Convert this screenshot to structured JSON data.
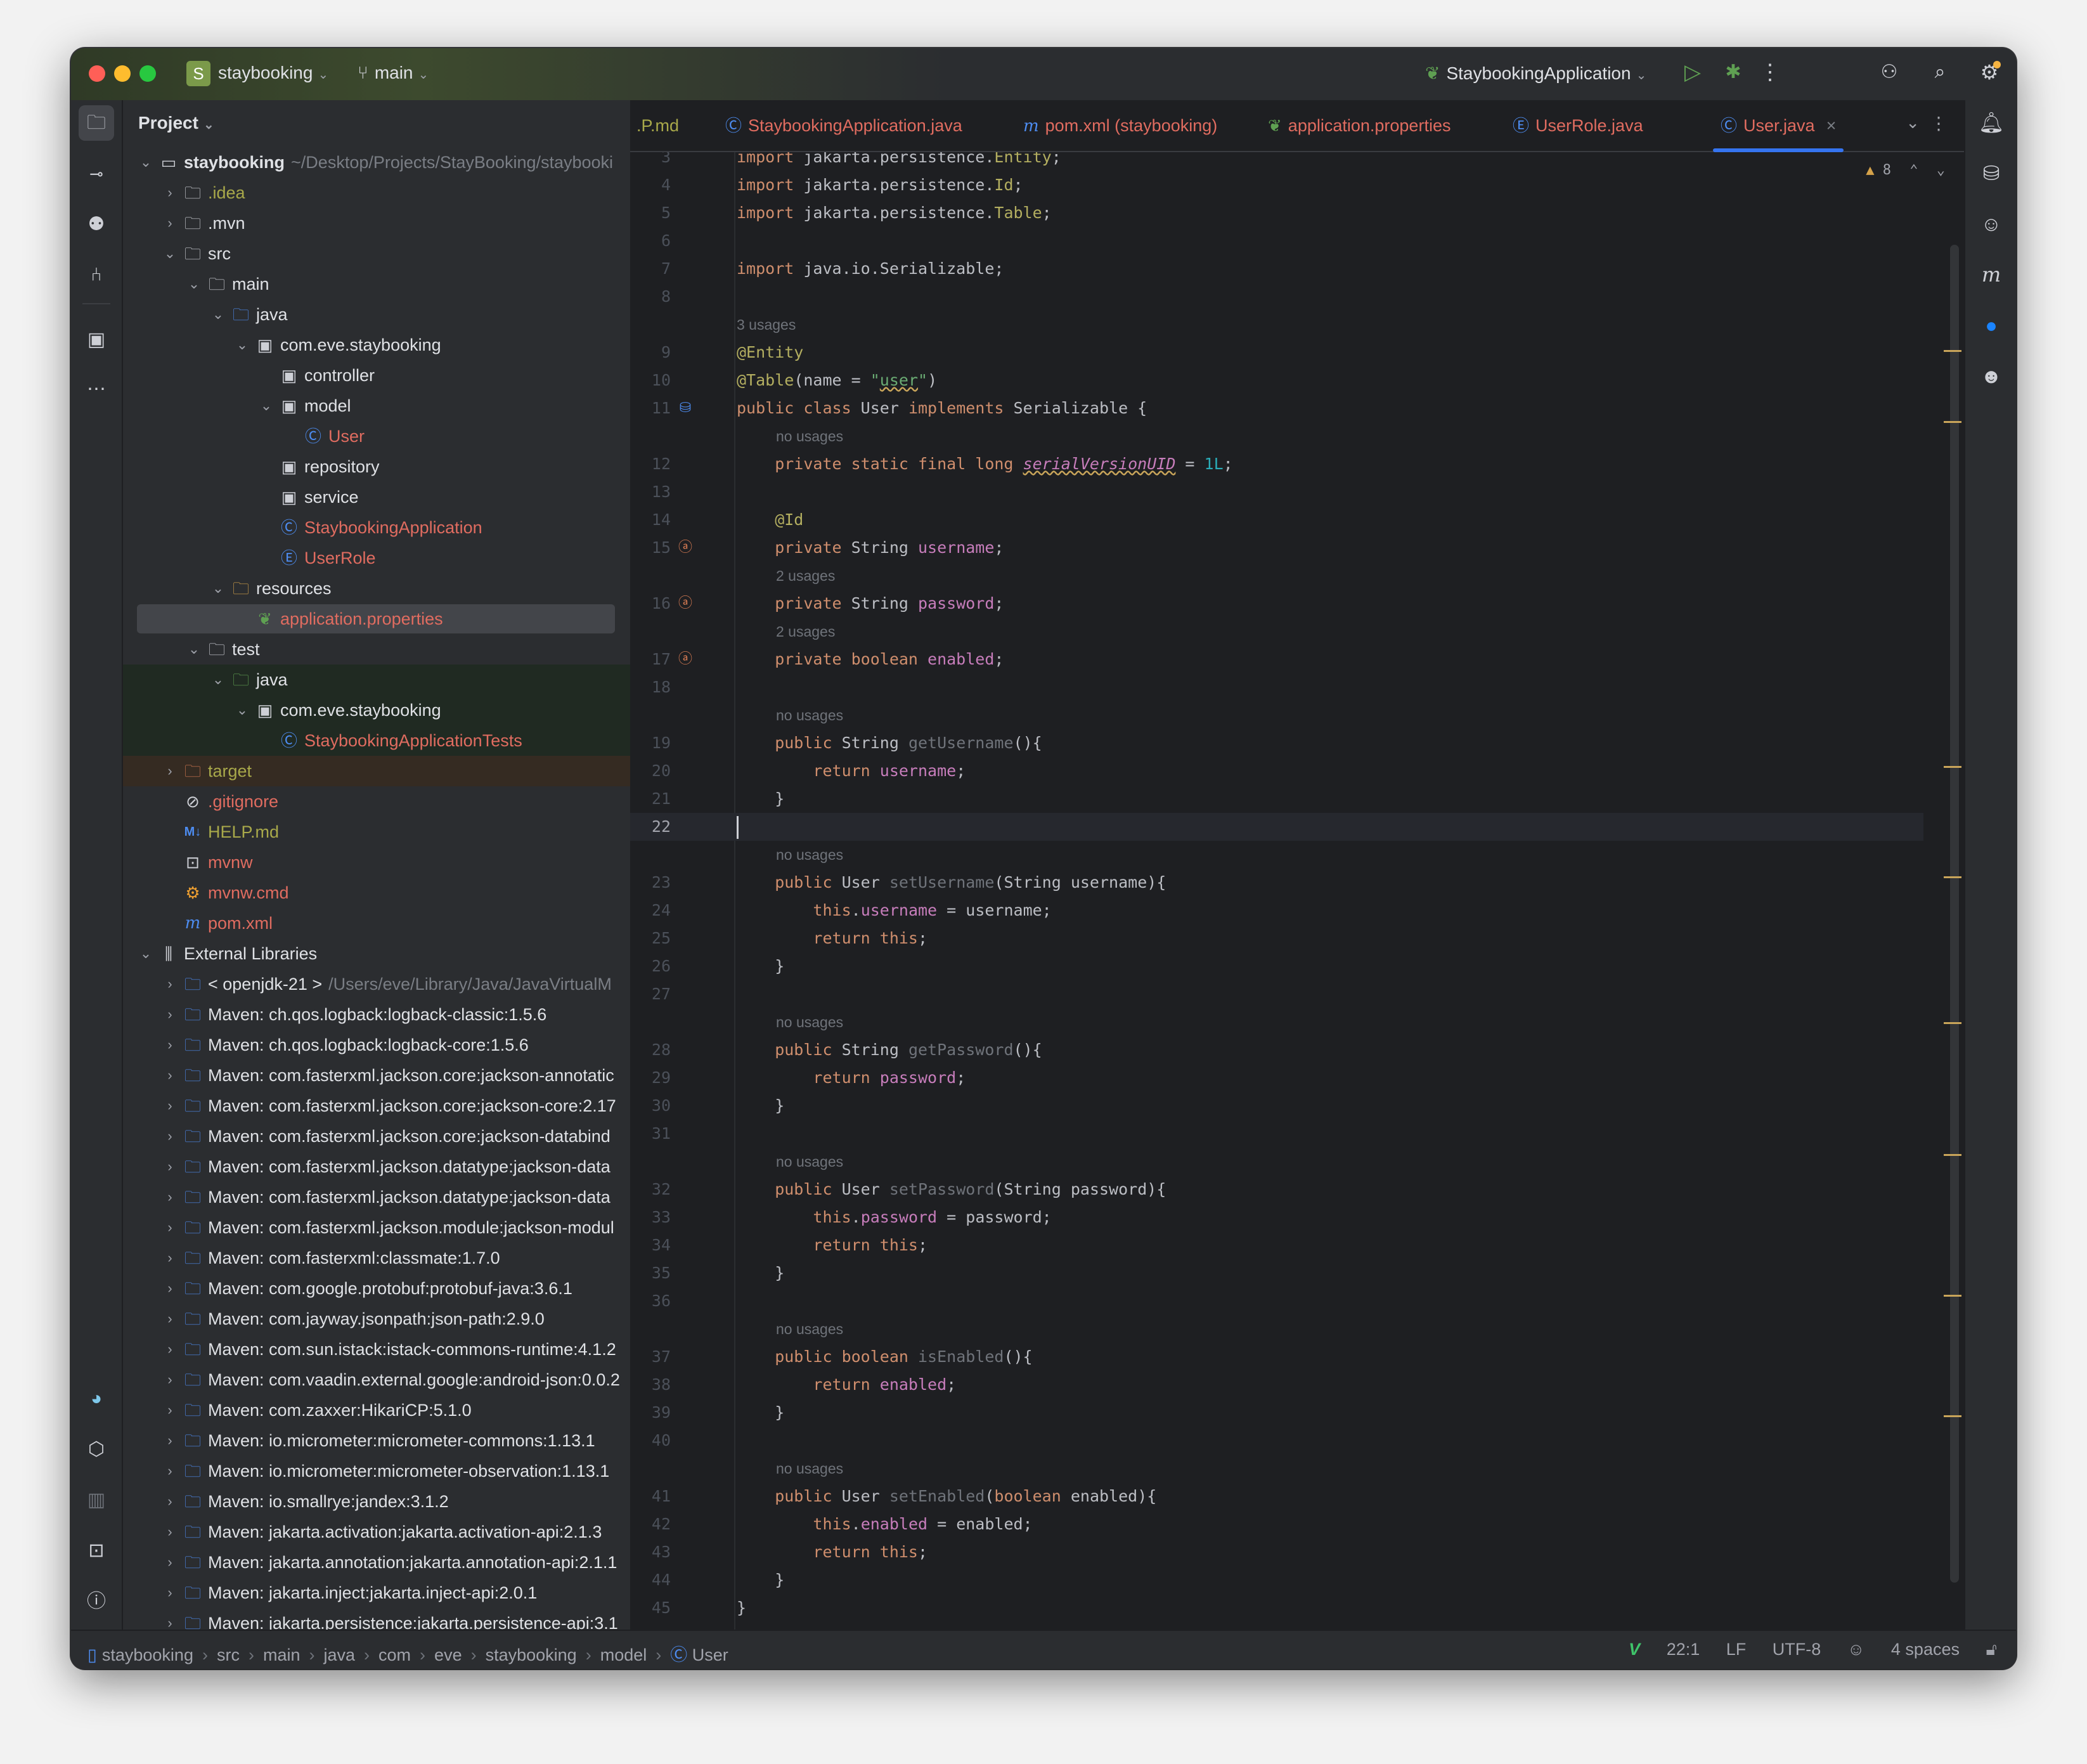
{
  "window": {
    "project_badge": "S",
    "project_name": "staybooking",
    "branch": "main",
    "run_config": "StaybookingApplication",
    "traffic_lights": {
      "close": "#ff5f57",
      "minimize": "#febc2e",
      "zoom": "#28c840"
    }
  },
  "left_toolbar": [
    {
      "name": "project-icon",
      "glyph": "🗀"
    },
    {
      "name": "commit-icon",
      "glyph": "-o-"
    },
    {
      "name": "ai-assistant-icon",
      "glyph": "?"
    },
    {
      "name": "pull-requests-icon",
      "glyph": "⇅"
    },
    {
      "name": "structure-icon",
      "glyph": "▣"
    },
    {
      "name": "more-icon",
      "glyph": "⋯"
    }
  ],
  "left_toolbar_bottom": [
    {
      "name": "gopher-plugin-icon",
      "glyph": "◕"
    },
    {
      "name": "services-icon",
      "glyph": "⬡"
    },
    {
      "name": "bracket-icon",
      "glyph": "[]"
    },
    {
      "name": "terminal-icon",
      "glyph": ">_"
    },
    {
      "name": "problems-icon",
      "glyph": "!"
    },
    {
      "name": "git-icon",
      "glyph": "⑂"
    }
  ],
  "project_panel": {
    "title": "Project",
    "tree": [
      {
        "depth": 0,
        "arrow": "down",
        "icon": "module",
        "label": "staybooking",
        "path": "~/Desktop/Projects/StayBooking/staybooki",
        "bold": true
      },
      {
        "depth": 1,
        "arrow": "right",
        "icon": "folder",
        "label": ".idea",
        "color": "olive"
      },
      {
        "depth": 1,
        "arrow": "right",
        "icon": "folder",
        "label": ".mvn"
      },
      {
        "depth": 1,
        "arrow": "down",
        "icon": "folder",
        "label": "src"
      },
      {
        "depth": 2,
        "arrow": "down",
        "icon": "folder",
        "label": "main"
      },
      {
        "depth": 3,
        "arrow": "down",
        "icon": "source-folder",
        "label": "java"
      },
      {
        "depth": 4,
        "arrow": "down",
        "icon": "package",
        "label": "com.eve.staybooking"
      },
      {
        "depth": 5,
        "arrow": "none",
        "icon": "package",
        "label": "controller"
      },
      {
        "depth": 5,
        "arrow": "down",
        "icon": "package",
        "label": "model"
      },
      {
        "depth": 6,
        "arrow": "none",
        "icon": "class",
        "label": "User",
        "color": "red"
      },
      {
        "depth": 5,
        "arrow": "none",
        "icon": "package",
        "label": "repository"
      },
      {
        "depth": 5,
        "arrow": "none",
        "icon": "package",
        "label": "service"
      },
      {
        "depth": 5,
        "arrow": "none",
        "icon": "spring-class",
        "label": "StaybookingApplication",
        "color": "red"
      },
      {
        "depth": 5,
        "arrow": "none",
        "icon": "enum",
        "label": "UserRole",
        "color": "red"
      },
      {
        "depth": 3,
        "arrow": "down",
        "icon": "resources-folder",
        "label": "resources"
      },
      {
        "depth": 4,
        "arrow": "none",
        "icon": "spring-leaf",
        "label": "application.properties",
        "color": "red",
        "selected": true
      },
      {
        "depth": 2,
        "arrow": "down",
        "icon": "folder",
        "label": "test"
      },
      {
        "depth": 3,
        "arrow": "down",
        "icon": "test-folder",
        "label": "java",
        "bg": "green"
      },
      {
        "depth": 4,
        "arrow": "down",
        "icon": "package",
        "label": "com.eve.staybooking",
        "bg": "green"
      },
      {
        "depth": 5,
        "arrow": "none",
        "icon": "class",
        "label": "StaybookingApplicationTests",
        "color": "red",
        "bg": "green"
      },
      {
        "depth": 1,
        "arrow": "right",
        "icon": "excluded-folder",
        "label": "target",
        "color": "olive",
        "bg": "brown"
      },
      {
        "depth": 1,
        "arrow": "none",
        "icon": "ignore",
        "label": ".gitignore",
        "color": "red"
      },
      {
        "depth": 1,
        "arrow": "none",
        "icon": "markdown",
        "label": "HELP.md",
        "color": "olive"
      },
      {
        "depth": 1,
        "arrow": "none",
        "icon": "shell",
        "label": "mvnw",
        "color": "red"
      },
      {
        "depth": 1,
        "arrow": "none",
        "icon": "cmd",
        "label": "mvnw.cmd",
        "color": "red"
      },
      {
        "depth": 1,
        "arrow": "none",
        "icon": "maven",
        "label": "pom.xml",
        "color": "red"
      },
      {
        "depth": 0,
        "arrow": "down",
        "icon": "libraries",
        "label": "External Libraries"
      },
      {
        "depth": 1,
        "arrow": "right",
        "icon": "jdk",
        "label": "< openjdk-21 >",
        "path": "/Users/eve/Library/Java/JavaVirtualM"
      },
      {
        "depth": 1,
        "arrow": "right",
        "icon": "library",
        "label": "Maven: ch.qos.logback:logback-classic:1.5.6"
      },
      {
        "depth": 1,
        "arrow": "right",
        "icon": "library",
        "label": "Maven: ch.qos.logback:logback-core:1.5.6"
      },
      {
        "depth": 1,
        "arrow": "right",
        "icon": "library",
        "label": "Maven: com.fasterxml.jackson.core:jackson-annotatic"
      },
      {
        "depth": 1,
        "arrow": "right",
        "icon": "library",
        "label": "Maven: com.fasterxml.jackson.core:jackson-core:2.17"
      },
      {
        "depth": 1,
        "arrow": "right",
        "icon": "library",
        "label": "Maven: com.fasterxml.jackson.core:jackson-databind"
      },
      {
        "depth": 1,
        "arrow": "right",
        "icon": "library",
        "label": "Maven: com.fasterxml.jackson.datatype:jackson-data"
      },
      {
        "depth": 1,
        "arrow": "right",
        "icon": "library",
        "label": "Maven: com.fasterxml.jackson.datatype:jackson-data"
      },
      {
        "depth": 1,
        "arrow": "right",
        "icon": "library",
        "label": "Maven: com.fasterxml.jackson.module:jackson-modul"
      },
      {
        "depth": 1,
        "arrow": "right",
        "icon": "library",
        "label": "Maven: com.fasterxml:classmate:1.7.0"
      },
      {
        "depth": 1,
        "arrow": "right",
        "icon": "library",
        "label": "Maven: com.google.protobuf:protobuf-java:3.6.1"
      },
      {
        "depth": 1,
        "arrow": "right",
        "icon": "library",
        "label": "Maven: com.jayway.jsonpath:json-path:2.9.0"
      },
      {
        "depth": 1,
        "arrow": "right",
        "icon": "library",
        "label": "Maven: com.sun.istack:istack-commons-runtime:4.1.2"
      },
      {
        "depth": 1,
        "arrow": "right",
        "icon": "library",
        "label": "Maven: com.vaadin.external.google:android-json:0.0.2"
      },
      {
        "depth": 1,
        "arrow": "right",
        "icon": "library",
        "label": "Maven: com.zaxxer:HikariCP:5.1.0"
      },
      {
        "depth": 1,
        "arrow": "right",
        "icon": "library",
        "label": "Maven: io.micrometer:micrometer-commons:1.13.1"
      },
      {
        "depth": 1,
        "arrow": "right",
        "icon": "library",
        "label": "Maven: io.micrometer:micrometer-observation:1.13.1"
      },
      {
        "depth": 1,
        "arrow": "right",
        "icon": "library",
        "label": "Maven: io.smallrye:jandex:3.1.2"
      },
      {
        "depth": 1,
        "arrow": "right",
        "icon": "library",
        "label": "Maven: jakarta.activation:jakarta.activation-api:2.1.3"
      },
      {
        "depth": 1,
        "arrow": "right",
        "icon": "library",
        "label": "Maven: jakarta.annotation:jakarta.annotation-api:2.1.1"
      },
      {
        "depth": 1,
        "arrow": "right",
        "icon": "library",
        "label": "Maven: jakarta.inject:jakarta.inject-api:2.0.1"
      },
      {
        "depth": 1,
        "arrow": "right",
        "icon": "library",
        "label": "Maven: jakarta.persistence:jakarta.persistence-api:3.1"
      }
    ]
  },
  "tabs": [
    {
      "label": ".P.md",
      "icon": "",
      "color": "olive"
    },
    {
      "label": "StaybookingApplication.java",
      "icon": "spring-class"
    },
    {
      "label": "pom.xml (staybooking)",
      "icon": "maven"
    },
    {
      "label": "application.properties",
      "icon": "spring-leaf"
    },
    {
      "label": "UserRole.java",
      "icon": "enum"
    },
    {
      "label": "User.java",
      "icon": "class",
      "active": true,
      "closable": true
    }
  ],
  "inspections": {
    "warnings": "8"
  },
  "editor": {
    "caret_line": 22,
    "lines": [
      {
        "n": "3",
        "tokens": [
          [
            "kw",
            "import "
          ],
          [
            "",
            "jakarta.persistence."
          ],
          [
            "an",
            "Entity"
          ],
          [
            "",
            ";"
          ]
        ]
      },
      {
        "n": "4",
        "tokens": [
          [
            "kw",
            "import "
          ],
          [
            "",
            "jakarta.persistence."
          ],
          [
            "an",
            "Id"
          ],
          [
            "",
            ";"
          ]
        ]
      },
      {
        "n": "5",
        "tokens": [
          [
            "kw",
            "import "
          ],
          [
            "",
            "jakarta.persistence."
          ],
          [
            "an",
            "Table"
          ],
          [
            "",
            ";"
          ]
        ]
      },
      {
        "n": "6",
        "tokens": []
      },
      {
        "n": "7",
        "tokens": [
          [
            "kw",
            "import "
          ],
          [
            "",
            "java.io.Serializable;"
          ]
        ]
      },
      {
        "n": "8",
        "tokens": []
      },
      {
        "hint": "3 usages",
        "indent": 0
      },
      {
        "n": "9",
        "tokens": [
          [
            "an",
            "@Entity"
          ]
        ]
      },
      {
        "n": "10",
        "tokens": [
          [
            "an",
            "@Table"
          ],
          [
            "",
            "(name = "
          ],
          [
            "st",
            "\""
          ],
          [
            "st sq",
            "user"
          ],
          [
            "st",
            "\""
          ],
          [
            "",
            ")"
          ]
        ]
      },
      {
        "n": "11",
        "gutter": "db-entity",
        "tokens": [
          [
            "kw",
            "public class "
          ],
          [
            "",
            "User "
          ],
          [
            "kw",
            "implements "
          ],
          [
            "",
            "Serializable {"
          ]
        ]
      },
      {
        "hint": "no usages",
        "indent": 1
      },
      {
        "n": "12",
        "tokens": [
          [
            "kw",
            "    private static final long "
          ],
          [
            "uf",
            "serialVersionUID"
          ],
          [
            "",
            " = "
          ],
          [
            "nm",
            "1L"
          ],
          [
            "",
            ";"
          ]
        ]
      },
      {
        "n": "13",
        "tokens": []
      },
      {
        "n": "14",
        "tokens": [
          [
            "an",
            "    @Id"
          ]
        ]
      },
      {
        "n": "15",
        "gutter": "id-field",
        "tokens": [
          [
            "kw",
            "    private "
          ],
          [
            "",
            "String "
          ],
          [
            "fd",
            "username"
          ],
          [
            "",
            ";"
          ]
        ]
      },
      {
        "hint": "2 usages",
        "indent": 1
      },
      {
        "n": "16",
        "gutter": "field",
        "tokens": [
          [
            "kw",
            "    private "
          ],
          [
            "",
            "String "
          ],
          [
            "fd",
            "password"
          ],
          [
            "",
            ";"
          ]
        ]
      },
      {
        "hint": "2 usages",
        "indent": 1
      },
      {
        "n": "17",
        "gutter": "field",
        "tokens": [
          [
            "kw",
            "    private boolean "
          ],
          [
            "fd",
            "enabled"
          ],
          [
            "",
            ";"
          ]
        ]
      },
      {
        "n": "18",
        "tokens": []
      },
      {
        "hint": "no usages",
        "indent": 1
      },
      {
        "n": "19",
        "tokens": [
          [
            "kw",
            "    public "
          ],
          [
            "",
            "String "
          ],
          [
            "fn",
            "getUsername"
          ],
          [
            "",
            "(){"
          ]
        ]
      },
      {
        "n": "20",
        "tokens": [
          [
            "kw",
            "        return "
          ],
          [
            "fd",
            "username"
          ],
          [
            "",
            ";"
          ]
        ]
      },
      {
        "n": "21",
        "tokens": [
          [
            "",
            "    }"
          ]
        ]
      },
      {
        "n": "22",
        "tokens": [],
        "current": true
      },
      {
        "hint": "no usages",
        "indent": 1
      },
      {
        "n": "23",
        "tokens": [
          [
            "kw",
            "    public "
          ],
          [
            "",
            "User "
          ],
          [
            "fn",
            "setUsername"
          ],
          [
            "",
            "(String username){"
          ]
        ]
      },
      {
        "n": "24",
        "tokens": [
          [
            "kw",
            "        this"
          ],
          [
            "",
            "."
          ],
          [
            "fd",
            "username"
          ],
          [
            "",
            " = username;"
          ]
        ]
      },
      {
        "n": "25",
        "tokens": [
          [
            "kw",
            "        return this"
          ],
          [
            "",
            ";"
          ]
        ]
      },
      {
        "n": "26",
        "tokens": [
          [
            "",
            "    }"
          ]
        ]
      },
      {
        "n": "27",
        "tokens": []
      },
      {
        "hint": "no usages",
        "indent": 1
      },
      {
        "n": "28",
        "tokens": [
          [
            "kw",
            "    public "
          ],
          [
            "",
            "String "
          ],
          [
            "fn",
            "getPassword"
          ],
          [
            "",
            "(){"
          ]
        ]
      },
      {
        "n": "29",
        "tokens": [
          [
            "kw",
            "        return "
          ],
          [
            "fd",
            "password"
          ],
          [
            "",
            ";"
          ]
        ]
      },
      {
        "n": "30",
        "tokens": [
          [
            "",
            "    }"
          ]
        ]
      },
      {
        "n": "31",
        "tokens": []
      },
      {
        "hint": "no usages",
        "indent": 1
      },
      {
        "n": "32",
        "tokens": [
          [
            "kw",
            "    public "
          ],
          [
            "",
            "User "
          ],
          [
            "fn",
            "setPassword"
          ],
          [
            "",
            "(String password){"
          ]
        ]
      },
      {
        "n": "33",
        "tokens": [
          [
            "kw",
            "        this"
          ],
          [
            "",
            "."
          ],
          [
            "fd",
            "password"
          ],
          [
            "",
            " = password;"
          ]
        ]
      },
      {
        "n": "34",
        "tokens": [
          [
            "kw",
            "        return this"
          ],
          [
            "",
            ";"
          ]
        ]
      },
      {
        "n": "35",
        "tokens": [
          [
            "",
            "    }"
          ]
        ]
      },
      {
        "n": "36",
        "tokens": []
      },
      {
        "hint": "no usages",
        "indent": 1
      },
      {
        "n": "37",
        "tokens": [
          [
            "kw",
            "    public boolean "
          ],
          [
            "fn",
            "isEnabled"
          ],
          [
            "",
            "(){"
          ]
        ]
      },
      {
        "n": "38",
        "tokens": [
          [
            "kw",
            "        return "
          ],
          [
            "fd",
            "enabled"
          ],
          [
            "",
            ";"
          ]
        ]
      },
      {
        "n": "39",
        "tokens": [
          [
            "",
            "    }"
          ]
        ]
      },
      {
        "n": "40",
        "tokens": []
      },
      {
        "hint": "no usages",
        "indent": 1
      },
      {
        "n": "41",
        "tokens": [
          [
            "kw",
            "    public "
          ],
          [
            "",
            "User "
          ],
          [
            "fn",
            "setEnabled"
          ],
          [
            "",
            "("
          ],
          [
            "kw",
            "boolean "
          ],
          [
            "",
            "enabled){"
          ]
        ]
      },
      {
        "n": "42",
        "tokens": [
          [
            "kw",
            "        this"
          ],
          [
            "",
            "."
          ],
          [
            "fd",
            "enabled"
          ],
          [
            "",
            " = enabled;"
          ]
        ]
      },
      {
        "n": "43",
        "tokens": [
          [
            "kw",
            "        return this"
          ],
          [
            "",
            ";"
          ]
        ]
      },
      {
        "n": "44",
        "tokens": [
          [
            "",
            "    }"
          ]
        ]
      },
      {
        "n": "45",
        "tokens": [
          [
            "",
            "}"
          ]
        ]
      }
    ]
  },
  "right_toolbar": [
    {
      "name": "notifications-icon",
      "glyph": "🔔"
    },
    {
      "name": "database-icon",
      "glyph": "⛁"
    },
    {
      "name": "copilot-icon",
      "glyph": "☺"
    },
    {
      "name": "maven-icon",
      "glyph": "m"
    },
    {
      "name": "chat-icon",
      "glyph": "●"
    },
    {
      "name": "copilot-chat-icon",
      "glyph": "☺"
    }
  ],
  "statusbar": {
    "breadcrumbs": [
      "staybooking",
      "src",
      "main",
      "java",
      "com",
      "eve",
      "staybooking",
      "model",
      "User"
    ],
    "position": "22:1",
    "line_ending": "LF",
    "encoding": "UTF-8",
    "indent": "4 spaces"
  }
}
